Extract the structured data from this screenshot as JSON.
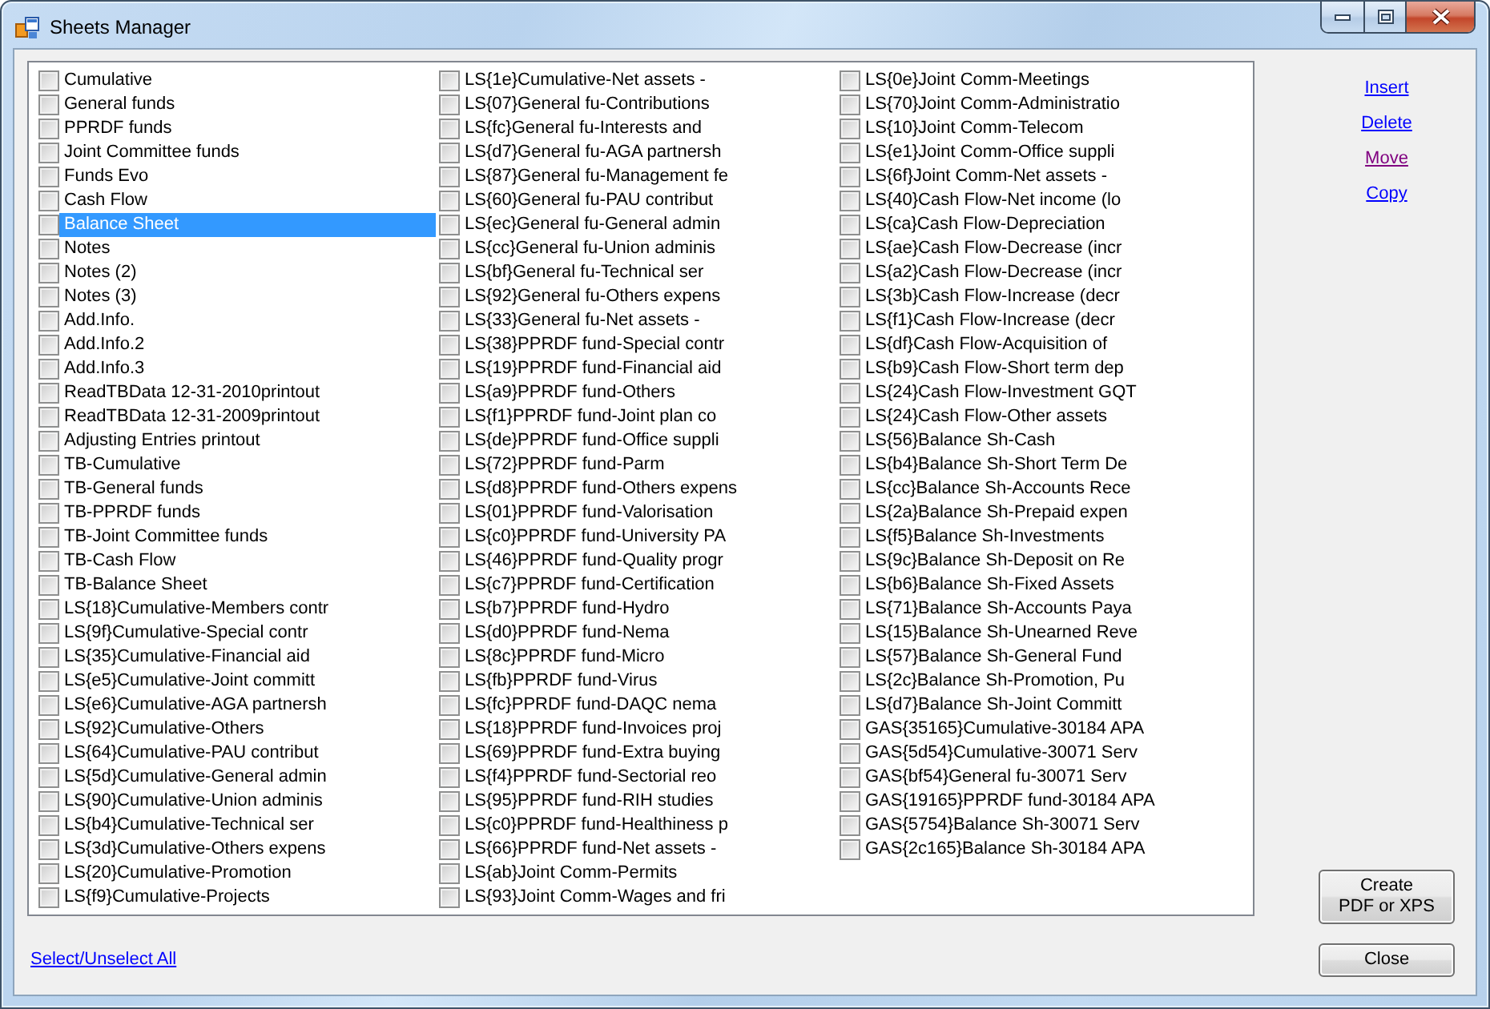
{
  "window": {
    "title": "Sheets Manager"
  },
  "sheets": {
    "items": [
      {
        "label": "Cumulative",
        "checked": false,
        "selected": false
      },
      {
        "label": "General funds",
        "checked": false,
        "selected": false
      },
      {
        "label": "PPRDF funds",
        "checked": false,
        "selected": false
      },
      {
        "label": "Joint Committee funds",
        "checked": false,
        "selected": false
      },
      {
        "label": "Funds Evo",
        "checked": false,
        "selected": false
      },
      {
        "label": "Cash Flow",
        "checked": false,
        "selected": false
      },
      {
        "label": "Balance Sheet",
        "checked": false,
        "selected": true
      },
      {
        "label": "Notes",
        "checked": false,
        "selected": false
      },
      {
        "label": "Notes (2)",
        "checked": false,
        "selected": false
      },
      {
        "label": "Notes (3)",
        "checked": false,
        "selected": false
      },
      {
        "label": "Add.Info.",
        "checked": false,
        "selected": false
      },
      {
        "label": "Add.Info.2",
        "checked": false,
        "selected": false
      },
      {
        "label": "Add.Info.3",
        "checked": false,
        "selected": false
      },
      {
        "label": "ReadTBData 12-31-2010printout",
        "checked": false,
        "selected": false
      },
      {
        "label": "ReadTBData 12-31-2009printout",
        "checked": false,
        "selected": false
      },
      {
        "label": "Adjusting Entries printout",
        "checked": false,
        "selected": false
      },
      {
        "label": "TB-Cumulative",
        "checked": false,
        "selected": false
      },
      {
        "label": "TB-General funds",
        "checked": false,
        "selected": false
      },
      {
        "label": "TB-PPRDF funds",
        "checked": false,
        "selected": false
      },
      {
        "label": "TB-Joint Committee funds",
        "checked": false,
        "selected": false
      },
      {
        "label": "TB-Cash Flow",
        "checked": false,
        "selected": false
      },
      {
        "label": "TB-Balance Sheet",
        "checked": false,
        "selected": false
      },
      {
        "label": "LS{18}Cumulative-Members contr",
        "checked": false,
        "selected": false
      },
      {
        "label": "LS{9f}Cumulative-Special contr",
        "checked": false,
        "selected": false
      },
      {
        "label": "LS{35}Cumulative-Financial aid",
        "checked": false,
        "selected": false
      },
      {
        "label": "LS{e5}Cumulative-Joint committ",
        "checked": false,
        "selected": false
      },
      {
        "label": "LS{e6}Cumulative-AGA partnersh",
        "checked": false,
        "selected": false
      },
      {
        "label": "LS{92}Cumulative-Others",
        "checked": false,
        "selected": false
      },
      {
        "label": "LS{64}Cumulative-PAU contribut",
        "checked": false,
        "selected": false
      },
      {
        "label": "LS{5d}Cumulative-General admin",
        "checked": false,
        "selected": false
      },
      {
        "label": "LS{90}Cumulative-Union adminis",
        "checked": false,
        "selected": false
      },
      {
        "label": "LS{b4}Cumulative-Technical ser",
        "checked": false,
        "selected": false
      },
      {
        "label": "LS{3d}Cumulative-Others expens",
        "checked": false,
        "selected": false
      },
      {
        "label": "LS{20}Cumulative-Promotion",
        "checked": false,
        "selected": false
      },
      {
        "label": "LS{f9}Cumulative-Projects",
        "checked": false,
        "selected": false
      },
      {
        "label": "LS{1e}Cumulative-Net assets -",
        "checked": false,
        "selected": false
      },
      {
        "label": "LS{07}General fu-Contributions",
        "checked": false,
        "selected": false
      },
      {
        "label": "LS{fc}General fu-Interests and",
        "checked": false,
        "selected": false
      },
      {
        "label": "LS{d7}General fu-AGA partnersh",
        "checked": false,
        "selected": false
      },
      {
        "label": "LS{87}General fu-Management fe",
        "checked": false,
        "selected": false
      },
      {
        "label": "LS{60}General fu-PAU contribut",
        "checked": false,
        "selected": false
      },
      {
        "label": "LS{ec}General fu-General admin",
        "checked": false,
        "selected": false
      },
      {
        "label": "LS{cc}General fu-Union adminis",
        "checked": false,
        "selected": false
      },
      {
        "label": "LS{bf}General fu-Technical ser",
        "checked": false,
        "selected": false
      },
      {
        "label": "LS{92}General fu-Others expens",
        "checked": false,
        "selected": false
      },
      {
        "label": "LS{33}General fu-Net assets -",
        "checked": false,
        "selected": false
      },
      {
        "label": "LS{38}PPRDF fund-Special contr",
        "checked": false,
        "selected": false
      },
      {
        "label": "LS{19}PPRDF fund-Financial aid",
        "checked": false,
        "selected": false
      },
      {
        "label": "LS{a9}PPRDF fund-Others",
        "checked": false,
        "selected": false
      },
      {
        "label": "LS{f1}PPRDF fund-Joint plan co",
        "checked": false,
        "selected": false
      },
      {
        "label": "LS{de}PPRDF fund-Office suppli",
        "checked": false,
        "selected": false
      },
      {
        "label": "LS{72}PPRDF fund-Parm",
        "checked": false,
        "selected": false
      },
      {
        "label": "LS{d8}PPRDF fund-Others expens",
        "checked": false,
        "selected": false
      },
      {
        "label": "LS{01}PPRDF fund-Valorisation",
        "checked": false,
        "selected": false
      },
      {
        "label": "LS{c0}PPRDF fund-University PA",
        "checked": false,
        "selected": false
      },
      {
        "label": "LS{46}PPRDF fund-Quality progr",
        "checked": false,
        "selected": false
      },
      {
        "label": "LS{c7}PPRDF fund-Certification",
        "checked": false,
        "selected": false
      },
      {
        "label": "LS{b7}PPRDF fund-Hydro",
        "checked": false,
        "selected": false
      },
      {
        "label": "LS{d0}PPRDF fund-Nema",
        "checked": false,
        "selected": false
      },
      {
        "label": "LS{8c}PPRDF fund-Micro",
        "checked": false,
        "selected": false
      },
      {
        "label": "LS{fb}PPRDF fund-Virus",
        "checked": false,
        "selected": false
      },
      {
        "label": "LS{fc}PPRDF fund-DAQC nema",
        "checked": false,
        "selected": false
      },
      {
        "label": "LS{18}PPRDF fund-Invoices proj",
        "checked": false,
        "selected": false
      },
      {
        "label": "LS{69}PPRDF fund-Extra buying",
        "checked": false,
        "selected": false
      },
      {
        "label": "LS{f4}PPRDF fund-Sectorial reo",
        "checked": false,
        "selected": false
      },
      {
        "label": "LS{95}PPRDF fund-RIH studies",
        "checked": false,
        "selected": false
      },
      {
        "label": "LS{c0}PPRDF fund-Healthiness p",
        "checked": false,
        "selected": false
      },
      {
        "label": "LS{66}PPRDF fund-Net assets -",
        "checked": false,
        "selected": false
      },
      {
        "label": "LS{ab}Joint Comm-Permits",
        "checked": false,
        "selected": false
      },
      {
        "label": "LS{93}Joint Comm-Wages and fri",
        "checked": false,
        "selected": false
      },
      {
        "label": "LS{0e}Joint Comm-Meetings",
        "checked": false,
        "selected": false
      },
      {
        "label": "LS{70}Joint Comm-Administratio",
        "checked": false,
        "selected": false
      },
      {
        "label": "LS{10}Joint Comm-Telecom",
        "checked": false,
        "selected": false
      },
      {
        "label": "LS{e1}Joint Comm-Office suppli",
        "checked": false,
        "selected": false
      },
      {
        "label": "LS{6f}Joint Comm-Net assets -",
        "checked": false,
        "selected": false
      },
      {
        "label": "LS{40}Cash Flow-Net income (lo",
        "checked": false,
        "selected": false
      },
      {
        "label": "LS{ca}Cash Flow-Depreciation",
        "checked": false,
        "selected": false
      },
      {
        "label": "LS{ae}Cash Flow-Decrease (incr",
        "checked": false,
        "selected": false
      },
      {
        "label": "LS{a2}Cash Flow-Decrease (incr",
        "checked": false,
        "selected": false
      },
      {
        "label": "LS{3b}Cash Flow-Increase (decr",
        "checked": false,
        "selected": false
      },
      {
        "label": "LS{f1}Cash Flow-Increase (decr",
        "checked": false,
        "selected": false
      },
      {
        "label": "LS{df}Cash Flow-Acquisition of",
        "checked": false,
        "selected": false
      },
      {
        "label": "LS{b9}Cash Flow-Short term dep",
        "checked": false,
        "selected": false
      },
      {
        "label": "LS{24}Cash Flow-Investment GQT",
        "checked": false,
        "selected": false
      },
      {
        "label": "LS{24}Cash Flow-Other assets",
        "checked": false,
        "selected": false
      },
      {
        "label": "LS{56}Balance Sh-Cash",
        "checked": false,
        "selected": false
      },
      {
        "label": "LS{b4}Balance Sh-Short Term De",
        "checked": false,
        "selected": false
      },
      {
        "label": "LS{cc}Balance Sh-Accounts Rece",
        "checked": false,
        "selected": false
      },
      {
        "label": "LS{2a}Balance Sh-Prepaid expen",
        "checked": false,
        "selected": false
      },
      {
        "label": "LS{f5}Balance Sh-Investments",
        "checked": false,
        "selected": false
      },
      {
        "label": "LS{9c}Balance Sh-Deposit on Re",
        "checked": false,
        "selected": false
      },
      {
        "label": "LS{b6}Balance Sh-Fixed Assets",
        "checked": false,
        "selected": false
      },
      {
        "label": "LS{71}Balance Sh-Accounts Paya",
        "checked": false,
        "selected": false
      },
      {
        "label": "LS{15}Balance Sh-Unearned Reve",
        "checked": false,
        "selected": false
      },
      {
        "label": "LS{57}Balance Sh-General Fund",
        "checked": false,
        "selected": false
      },
      {
        "label": "LS{2c}Balance Sh-Promotion, Pu",
        "checked": false,
        "selected": false
      },
      {
        "label": "LS{d7}Balance Sh-Joint Committ",
        "checked": false,
        "selected": false
      },
      {
        "label": "GAS{35165}Cumulative-30184 APA",
        "checked": false,
        "selected": false
      },
      {
        "label": "GAS{5d54}Cumulative-30071 Serv",
        "checked": false,
        "selected": false
      },
      {
        "label": "GAS{bf54}General fu-30071 Serv",
        "checked": false,
        "selected": false
      },
      {
        "label": "GAS{19165}PPRDF fund-30184 APA",
        "checked": false,
        "selected": false
      },
      {
        "label": "GAS{5754}Balance Sh-30071 Serv",
        "checked": false,
        "selected": false
      },
      {
        "label": "GAS{2c165}Balance Sh-30184 APA",
        "checked": false,
        "selected": false
      }
    ]
  },
  "actions": {
    "links": [
      {
        "label": "Insert",
        "visited": false
      },
      {
        "label": "Delete",
        "visited": false
      },
      {
        "label": "Move",
        "visited": true
      },
      {
        "label": "Copy",
        "visited": false
      }
    ]
  },
  "create_button": {
    "label": "Create\nPDF or XPS"
  },
  "select_all_link": {
    "label": "Select/Unselect All"
  },
  "close_button": {
    "label": "Close"
  }
}
